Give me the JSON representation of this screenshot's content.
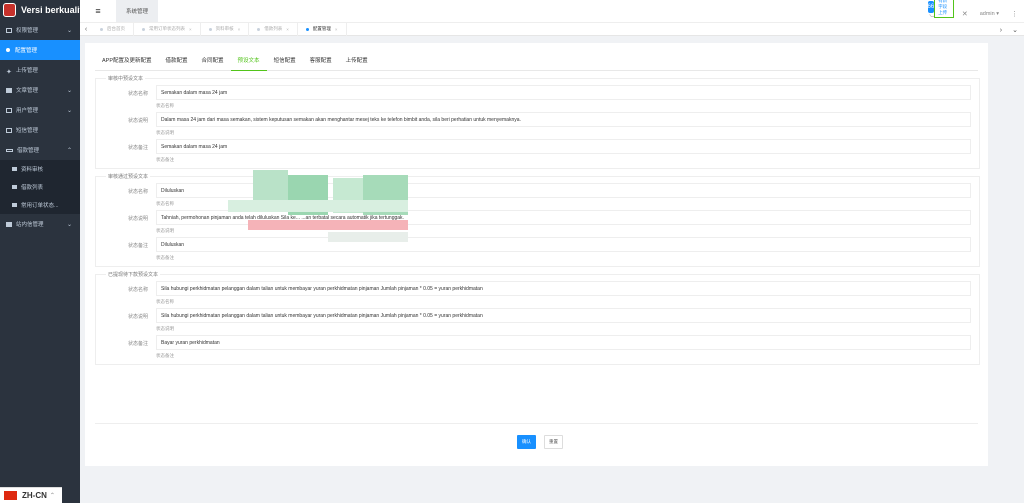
{
  "app": {
    "title": "Versi berkualiti"
  },
  "sidebar": {
    "items": [
      {
        "label": "权限管理",
        "icon": "monitor-icon",
        "chevron": "v"
      },
      {
        "label": "配置管理",
        "icon": "dot-icon",
        "active": true
      },
      {
        "label": "上传管理",
        "icon": "upload-icon"
      },
      {
        "label": "文章管理",
        "icon": "article-icon",
        "chevron": "v"
      },
      {
        "label": "用户管理",
        "icon": "user-icon",
        "chevron": "v"
      },
      {
        "label": "短信管理",
        "icon": "sms-icon"
      },
      {
        "label": "借款管理",
        "icon": "loan-icon",
        "chevron": "^"
      }
    ],
    "submenu": [
      {
        "label": "资料审核"
      },
      {
        "label": "借款列表"
      },
      {
        "label": "常用订单状态..."
      }
    ],
    "after": [
      {
        "label": "站内信管理",
        "chevron": "v"
      }
    ],
    "lang": "ZH-CN"
  },
  "topbar": {
    "menu_icon": "≡",
    "system_tab": "系统管理",
    "badge_text": "有新字段上传",
    "badge_icon": "66",
    "admin": "admin ▾"
  },
  "tags": [
    {
      "label": "后台首页",
      "closable": false
    },
    {
      "label": "常用订单状态列表",
      "closable": true
    },
    {
      "label": "资料审核",
      "closable": true
    },
    {
      "label": "借款列表",
      "closable": true
    },
    {
      "label": "配置管理",
      "closable": true,
      "active": true
    }
  ],
  "tabs": [
    {
      "label": "APP配置及更新配置"
    },
    {
      "label": "借款配置"
    },
    {
      "label": "合同配置"
    },
    {
      "label": "预设文本",
      "active": true
    },
    {
      "label": "短信配置"
    },
    {
      "label": "客服配置"
    },
    {
      "label": "上传配置"
    }
  ],
  "sections": [
    {
      "legend": "审核中预设文本",
      "fields": [
        {
          "label": "状态名称",
          "value": "Semakan dalam masa 24 jam",
          "hint": "状态名称"
        },
        {
          "label": "状态说明",
          "value": "Dalam masa 24 jam dari masa semakan, sistem keputusan semakan akan menghantar mesej teks ke telefon bimbit anda, sila beri perhatian untuk menyemaknya.",
          "hint": "状态说明"
        },
        {
          "label": "状态备注",
          "value": "Semakan dalam masa 24 jam",
          "hint": "状态备注"
        }
      ]
    },
    {
      "legend": "审核通过预设文本",
      "fields": [
        {
          "label": "状态名称",
          "value": "Diluluskan",
          "hint": "状态名称"
        },
        {
          "label": "状态说明",
          "value": "Tahniah, permohonan pinjaman anda telah diluluskan Sila ke...                    ...an terbatal secara automatik jika tertunggak.",
          "hint": "状态说明"
        },
        {
          "label": "状态备注",
          "value": "Diluluskan",
          "hint": "状态备注"
        }
      ]
    },
    {
      "legend": "已提现待下款预设文本",
      "fields": [
        {
          "label": "状态名称",
          "value": "Sila hubungi perkhidmatan pelanggan dalam talian untuk membayar yuran perkhidmatan pinjaman Jumlah pinjaman * 0.05 = yuran perkhidmatan",
          "hint": "状态名称"
        },
        {
          "label": "状态说明",
          "value": "Sila hubungi perkhidmatan pelanggan dalam talian untuk membayar yuran perkhidmatan pinjaman Jumlah pinjaman * 0.05 = yuran perkhidmatan",
          "hint": "状态说明"
        },
        {
          "label": "状态备注",
          "value": "Bayar yuran perkhidmatan",
          "hint": "状态备注"
        }
      ]
    }
  ],
  "actions": {
    "confirm": "确认",
    "reset": "重置"
  },
  "colors": {
    "primary": "#1890ff",
    "sidebar_bg": "#2b333e",
    "tab_active": "#52c41a"
  }
}
